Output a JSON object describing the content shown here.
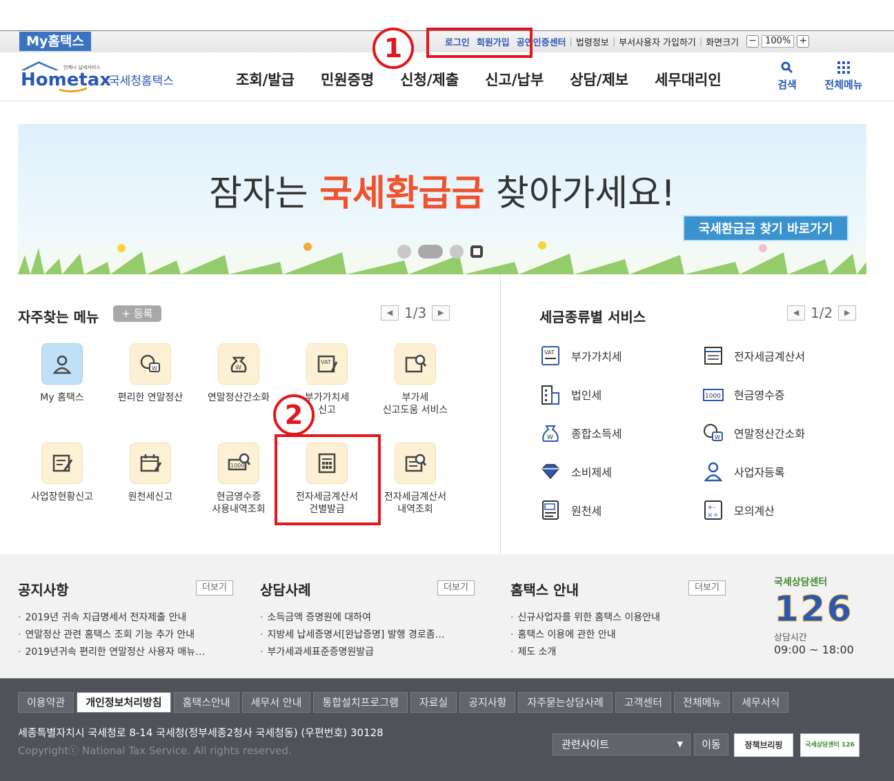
{
  "topbar": {
    "my_hometax": "My홈택스",
    "login": "로그인",
    "signup": "회원가입",
    "cert_center": "공인인증센터",
    "law_info": "법령정보",
    "dept_signup": "부서사용자 가입하기",
    "screen_size": "화면크기",
    "zoom_minus": "−",
    "zoom_value": "100%",
    "zoom_plus": "+"
  },
  "logo": {
    "small": "언제나 납세서비스",
    "brand": "Hometax",
    "name": "국세청홈택스"
  },
  "nav": [
    "조회/발급",
    "민원증명",
    "신청/제출",
    "신고/납부",
    "상담/제보",
    "세무대리인"
  ],
  "header_icons": {
    "search": "검색",
    "all_menu": "전체메뉴"
  },
  "banner": {
    "text_before": "잠자는 ",
    "text_highlight": "국세환급금",
    "text_after": " 찾아가세요!",
    "button": "국세환급금 찾기 바로가기",
    "slide_count": 4
  },
  "favorites": {
    "title": "자주찾는 메뉴",
    "register": "+ 등록",
    "page": "1/3",
    "prev": "◀",
    "next": "▶",
    "items": [
      {
        "line1": "My 홈택스",
        "line2": "",
        "icon": "person-icon"
      },
      {
        "line1": "편리한 연말정산",
        "line2": "",
        "icon": "coin-chat-icon"
      },
      {
        "line1": "연말정산간소화",
        "line2": "",
        "icon": "money-bag-icon"
      },
      {
        "line1": "부가가치세",
        "line2": "신고",
        "icon": "vat-doc-icon"
      },
      {
        "line1": "부가세",
        "line2": "신고도움 서비스",
        "icon": "doc-search-icon"
      },
      {
        "line1": "사업장현황신고",
        "line2": "",
        "icon": "edit-doc-icon"
      },
      {
        "line1": "원천세신고",
        "line2": "",
        "icon": "calendar-edit-icon"
      },
      {
        "line1": "현금영수증",
        "line2": "사용내역조회",
        "icon": "receipt-search-icon"
      },
      {
        "line1": "전자세금계산서",
        "line2": "건별발급",
        "icon": "calculator-doc-icon"
      },
      {
        "line1": "전자세금계산서",
        "line2": "내역조회",
        "icon": "invoice-search-icon"
      }
    ]
  },
  "tax_services": {
    "title": "세금종류별 서비스",
    "page": "1/2",
    "prev": "◀",
    "next": "▶",
    "left": [
      {
        "label": "부가가치세",
        "icon": "vat-icon"
      },
      {
        "label": "법인세",
        "icon": "building-icon"
      },
      {
        "label": "종합소득세",
        "icon": "won-bag-icon"
      },
      {
        "label": "소비제세",
        "icon": "diamond-icon"
      },
      {
        "label": "원천세",
        "icon": "salary-doc-icon"
      }
    ],
    "right": [
      {
        "label": "전자세금계산서",
        "icon": "e-invoice-icon"
      },
      {
        "label": "현금영수증",
        "icon": "cash-receipt-icon"
      },
      {
        "label": "연말정산간소화",
        "icon": "coin-chat-icon"
      },
      {
        "label": "사업자등록",
        "icon": "person-icon"
      },
      {
        "label": "모의계산",
        "icon": "calculator-icon"
      }
    ]
  },
  "callouts": {
    "one": "1",
    "two": "2"
  },
  "notices": {
    "more": "더보기",
    "cols": [
      {
        "title": "공지사항",
        "items": [
          "2019년 귀속 지급명세서 전자제출 안내",
          "연말정산 관련 홈택스 조회 기능 추가 안내",
          "2019년귀속 편리한 연말정산 사용자 매뉴…"
        ]
      },
      {
        "title": "상담사례",
        "items": [
          "소득금액 증명원에 대하여",
          "지방세 납세증명서[완납증명] 발행 경로좀…",
          "부가세과세표준증명원발급"
        ]
      },
      {
        "title": "홈택스 안내",
        "items": [
          "신규사업자를 위한 홈택스 이용안내",
          "홈택스 이용에 관한 안내",
          "제도 소개"
        ]
      }
    ]
  },
  "call_center": {
    "title": "국세상담센터",
    "number": "126",
    "hours_label": "상담시간",
    "hours": "09:00 ~ 18:00"
  },
  "footer": {
    "links": [
      "이용약관",
      "개인정보처리방침",
      "홈택스안내",
      "세무서 안내",
      "통합설치프로그램",
      "자료실",
      "공지사항",
      "자주묻는상담사례",
      "고객센터",
      "전체메뉴",
      "세무서식"
    ],
    "address": "세종특별자치시 국세청로 8-14 국세청(정부세종2청사 국세청동) (우편번호) 30128",
    "copyright": "Copyrightⓒ National Tax Service. All rights reserved.",
    "related_sites": "관련사이트",
    "go": "이동",
    "policy_banner": "정책브리핑",
    "center_banner": "국세상담센터 126"
  },
  "colors": {
    "accent_blue": "#2a58b5",
    "highlight_red": "#e3161b",
    "banner_orange": "#f0522e"
  }
}
